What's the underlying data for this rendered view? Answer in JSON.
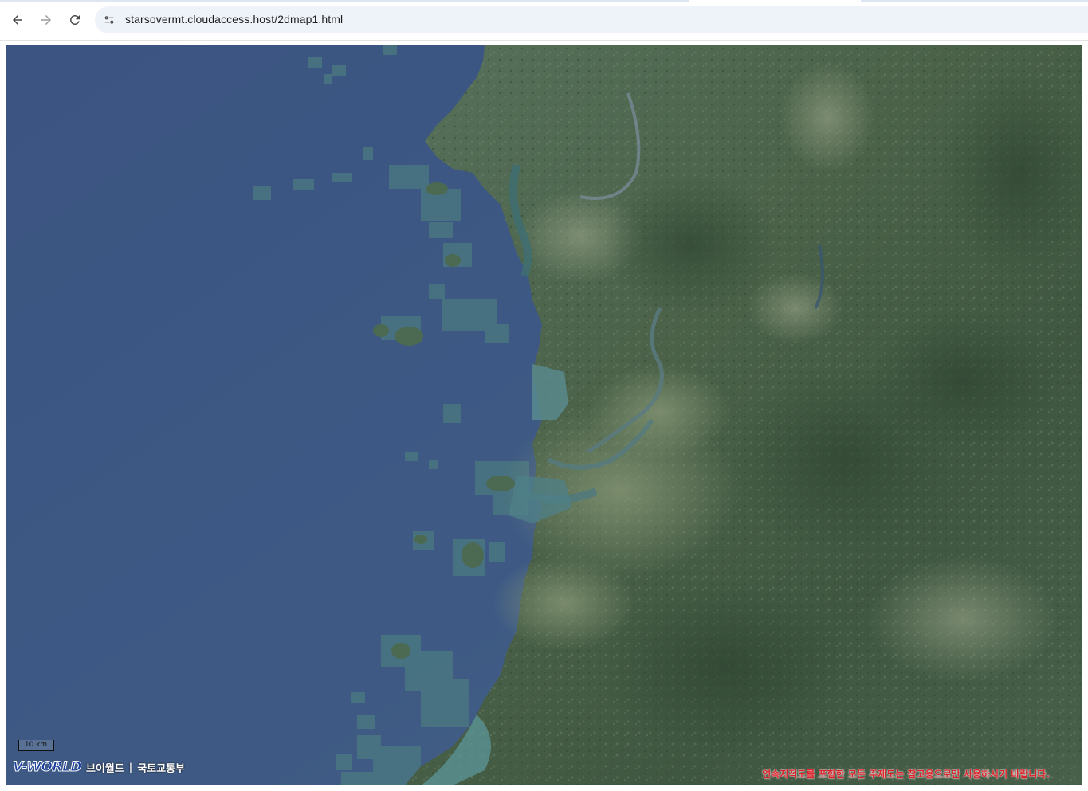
{
  "browser": {
    "url": "starsovermt.cloudaccess.host/2dmap1.html",
    "buttons": {
      "back_icon": "arrow-left-icon",
      "forward_icon": "arrow-right-icon",
      "reload_icon": "reload-icon",
      "site_info_icon": "tune-icon"
    }
  },
  "map": {
    "view": "satellite",
    "sea_color": "#3d5882",
    "land_color": "#4a6048",
    "scale_label": "10 km",
    "logo": {
      "mark": "V-WORLD",
      "name": "브이월드",
      "separator": "|",
      "ministry": "국토교통부"
    },
    "notice": "연속지적도를 포함한 모든 주제도는 참고용으로만 사용하시기 바랍니다."
  }
}
